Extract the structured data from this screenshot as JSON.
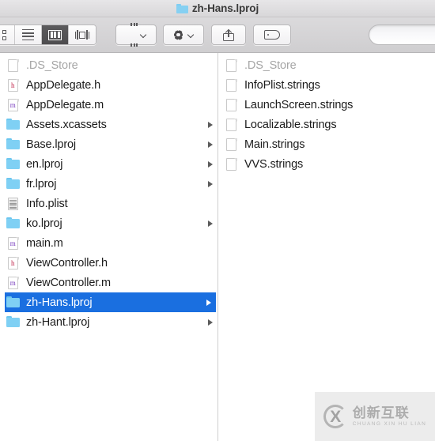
{
  "window": {
    "title": "zh-Hans.lproj",
    "title_icon": "folder-icon"
  },
  "toolbar": {
    "view_buttons": [
      {
        "name": "icon-view",
        "icon": "grid-icon",
        "active": false
      },
      {
        "name": "list-view",
        "icon": "list-icon",
        "active": false
      },
      {
        "name": "column-view",
        "icon": "columns-icon",
        "active": true
      },
      {
        "name": "coverflow-view",
        "icon": "coverflow-icon",
        "active": false
      }
    ],
    "arrange_button": {
      "name": "arrange-by",
      "icon": "arrange-icon"
    },
    "action_button": {
      "name": "action-menu",
      "icon": "gear-icon"
    },
    "share_button": {
      "name": "share",
      "icon": "share-icon"
    },
    "tag_button": {
      "name": "edit-tags",
      "icon": "tag-icon"
    },
    "search": {
      "placeholder": "",
      "value": ""
    }
  },
  "columns": [
    {
      "name": "left-column",
      "items": [
        {
          "label": ".DS_Store",
          "icon": "blank-document-icon",
          "dimmed": true,
          "selected": false,
          "disclosure": false
        },
        {
          "label": "AppDelegate.h",
          "icon": "h-document-icon",
          "dimmed": false,
          "selected": false,
          "disclosure": false
        },
        {
          "label": "AppDelegate.m",
          "icon": "m-document-icon",
          "dimmed": false,
          "selected": false,
          "disclosure": false
        },
        {
          "label": "Assets.xcassets",
          "icon": "folder-icon",
          "dimmed": false,
          "selected": false,
          "disclosure": true
        },
        {
          "label": "Base.lproj",
          "icon": "folder-icon",
          "dimmed": false,
          "selected": false,
          "disclosure": true
        },
        {
          "label": "en.lproj",
          "icon": "folder-icon",
          "dimmed": false,
          "selected": false,
          "disclosure": true
        },
        {
          "label": "fr.lproj",
          "icon": "folder-icon",
          "dimmed": false,
          "selected": false,
          "disclosure": true
        },
        {
          "label": "Info.plist",
          "icon": "plist-document-icon",
          "dimmed": false,
          "selected": false,
          "disclosure": false
        },
        {
          "label": "ko.lproj",
          "icon": "folder-icon",
          "dimmed": false,
          "selected": false,
          "disclosure": true
        },
        {
          "label": "main.m",
          "icon": "m-document-icon",
          "dimmed": false,
          "selected": false,
          "disclosure": false
        },
        {
          "label": "ViewController.h",
          "icon": "h-document-icon",
          "dimmed": false,
          "selected": false,
          "disclosure": false
        },
        {
          "label": "ViewController.m",
          "icon": "m-document-icon",
          "dimmed": false,
          "selected": false,
          "disclosure": false
        },
        {
          "label": "zh-Hans.lproj",
          "icon": "folder-icon",
          "dimmed": false,
          "selected": true,
          "disclosure": true
        },
        {
          "label": "zh-Hant.lproj",
          "icon": "folder-icon",
          "dimmed": false,
          "selected": false,
          "disclosure": true
        }
      ]
    },
    {
      "name": "right-column",
      "items": [
        {
          "label": ".DS_Store",
          "icon": "blank-document-icon",
          "dimmed": true,
          "selected": false,
          "disclosure": false
        },
        {
          "label": "InfoPlist.strings",
          "icon": "blank-document-icon",
          "dimmed": false,
          "selected": false,
          "disclosure": false
        },
        {
          "label": "LaunchScreen.strings",
          "icon": "blank-document-icon",
          "dimmed": false,
          "selected": false,
          "disclosure": false
        },
        {
          "label": "Localizable.strings",
          "icon": "blank-document-icon",
          "dimmed": false,
          "selected": false,
          "disclosure": false
        },
        {
          "label": "Main.strings",
          "icon": "blank-document-icon",
          "dimmed": false,
          "selected": false,
          "disclosure": false
        },
        {
          "label": "VVS.strings",
          "icon": "blank-document-icon",
          "dimmed": false,
          "selected": false,
          "disclosure": false
        }
      ]
    }
  ],
  "watermark": {
    "cn": "创新互联",
    "en": "CHUANG XIN HU LIAN",
    "mark": "X"
  },
  "colors": {
    "selection": "#1a6fe0",
    "folder": "#7fd0f4",
    "toolbar": "#d3d2d4",
    "dimmed_text": "#a6a6a6"
  }
}
